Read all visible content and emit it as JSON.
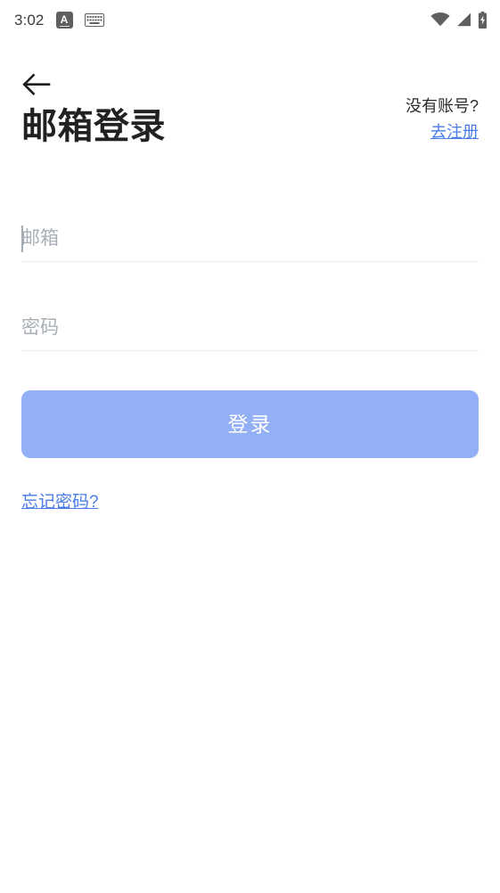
{
  "status_bar": {
    "clock": "3:02",
    "app_badge_label": "A",
    "icons": [
      "app-badge-icon",
      "keyboard-icon",
      "wifi-icon",
      "cellular-signal-icon",
      "battery-charging-icon"
    ]
  },
  "header": {
    "back_icon": "back-arrow-icon",
    "title": "邮箱登录",
    "register_hint": "没有账号?",
    "register_link": "去注册"
  },
  "form": {
    "email": {
      "placeholder": "邮箱",
      "value": ""
    },
    "password": {
      "placeholder": "密码",
      "value": ""
    },
    "submit_label": "登录",
    "forgot_label": "忘记密码?"
  },
  "colors": {
    "link_blue": "#4a7ce8",
    "button_blue": "#93b0f7",
    "title_black": "#212121",
    "placeholder_gray": "#a9afb6",
    "divider_gray": "#eceef0",
    "background": "#ffffff"
  }
}
